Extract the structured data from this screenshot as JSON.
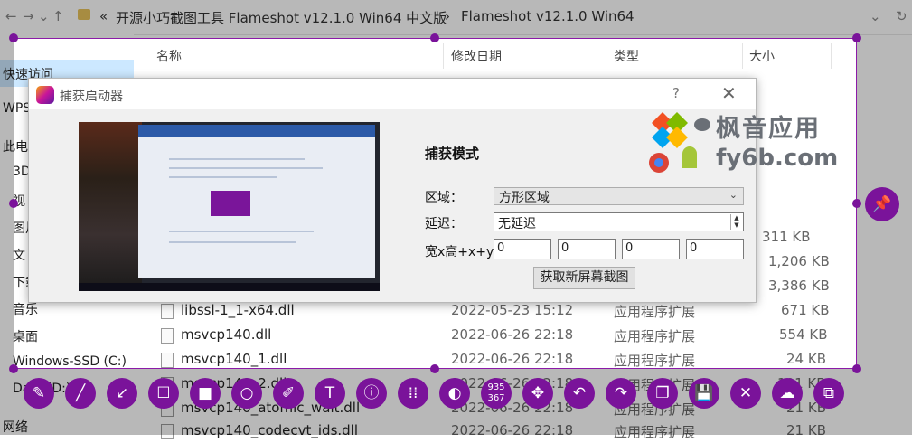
{
  "address_bar": {
    "back": "←",
    "forward": "→",
    "dropdown": "⌄",
    "up": "↑",
    "chevron": "«",
    "crumb1": "开源小巧截图工具 Flameshot v12.1.0 Win64 中文版",
    "sep": "›",
    "crumb2": "Flameshot v12.1.0 Win64",
    "expand": "⌄",
    "refresh": "↻"
  },
  "sidebar": {
    "items": [
      "快速访问",
      "WPS",
      "此电",
      "3D",
      "视",
      "图片",
      "文",
      "下载",
      "音乐",
      "桌面",
      "Windows-SSD (C:)",
      "Data (D:)",
      "网络"
    ]
  },
  "columns": {
    "name": "名称",
    "modified": "修改日期",
    "type": "类型",
    "size": "大小"
  },
  "files": [
    {
      "name": "",
      "modified": "",
      "type": "",
      "size": "311 KB"
    },
    {
      "name": "",
      "modified": "",
      "type": "",
      "size": "1,206 KB"
    },
    {
      "name": "",
      "modified": "",
      "type": "",
      "size": "3,386 KB"
    },
    {
      "name": "libssl-1_1-x64.dll",
      "modified": "2022-05-23 15:12",
      "type": "应用程序扩展",
      "size": "671 KB"
    },
    {
      "name": "msvcp140.dll",
      "modified": "2022-06-26 22:18",
      "type": "应用程序扩展",
      "size": "554 KB"
    },
    {
      "name": "msvcp140_1.dll",
      "modified": "2022-06-26 22:18",
      "type": "应用程序扩展",
      "size": "24 KB"
    },
    {
      "name": "msvcp140_2.dll",
      "modified": "2022-06-26 22:18",
      "type": "应用程序扩展",
      "size": "191 KB"
    },
    {
      "name": "msvcp140_atomic_wait.dll",
      "modified": "2022-06-26 22:18",
      "type": "应用程序扩展",
      "size": "21 KB"
    },
    {
      "name": "msvcp140_codecvt_ids.dll",
      "modified": "2022-06-26 22:18",
      "type": "应用程序扩展",
      "size": "21 KB"
    }
  ],
  "dialog": {
    "title": "捕获启动器",
    "help": "?",
    "close": "✕",
    "capture_mode": "捕获模式",
    "area_label": "区域：",
    "area_value": "方形区域",
    "area_arrow": "⌄",
    "delay_label": "延迟：",
    "delay_value": "无延迟",
    "spin_up": "▲",
    "spin_down": "▼",
    "geometry_label": "宽x高+x+y",
    "geometry_values": [
      "0",
      "0",
      "0",
      "0"
    ],
    "new_capture_button": "获取新屏幕截图"
  },
  "watermark": {
    "line1": "枫音应用",
    "line2": "fy6b.com"
  },
  "selection_size": {
    "width": "935",
    "height": "367"
  },
  "toolbar": {
    "tools": [
      {
        "name": "pencil-icon",
        "glyph": "✎"
      },
      {
        "name": "line-icon",
        "glyph": "╱"
      },
      {
        "name": "arrow-icon",
        "glyph": "↙"
      },
      {
        "name": "rectangle-icon",
        "glyph": "☐"
      },
      {
        "name": "filled-rectangle-icon",
        "glyph": "■"
      },
      {
        "name": "circle-icon",
        "glyph": "○"
      },
      {
        "name": "marker-icon",
        "glyph": "✐"
      },
      {
        "name": "text-icon",
        "glyph": "T"
      },
      {
        "name": "circle-count-icon",
        "glyph": "ⓘ"
      },
      {
        "name": "pixelate-icon",
        "glyph": "⁞⁞"
      },
      {
        "name": "invert-icon",
        "glyph": "◐"
      },
      {
        "name": "size-indicator",
        "glyph": ""
      },
      {
        "name": "move-icon",
        "glyph": "✥"
      },
      {
        "name": "undo-icon",
        "glyph": "↶"
      },
      {
        "name": "redo-icon",
        "glyph": "↷"
      },
      {
        "name": "copy-icon",
        "glyph": "❐"
      },
      {
        "name": "save-icon",
        "glyph": "💾"
      },
      {
        "name": "exit-icon",
        "glyph": "✕"
      },
      {
        "name": "upload-icon",
        "glyph": "☁"
      },
      {
        "name": "open-app-icon",
        "glyph": "⧉"
      }
    ],
    "pin_glyph": "📌"
  },
  "colors": {
    "accent": "#7a139a",
    "selection_border": "#8c1aa8",
    "dialog_bg": "#f0f0f0"
  }
}
